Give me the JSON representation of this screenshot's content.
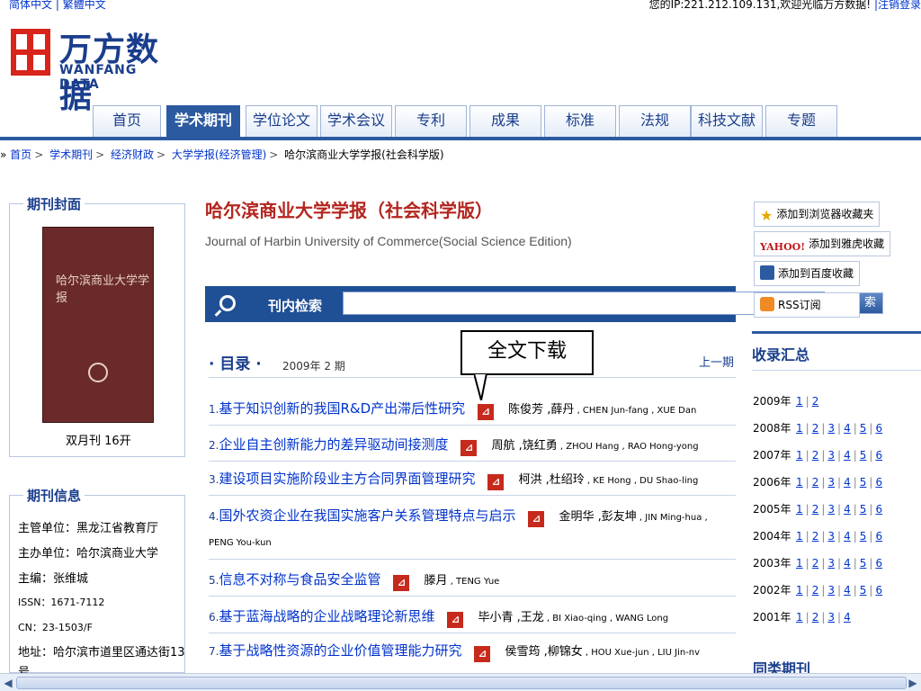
{
  "topbar": {
    "lang_simplified": "简体中文",
    "lang_sep": "|",
    "lang_traditional": "繁體中文",
    "welcome": "您的IP:221.212.109.131,欢迎光临万方数据!",
    "logout": "|注销登录"
  },
  "logo": {
    "cn": "万方数据",
    "en": "WANFANG DATA"
  },
  "nav": {
    "tabs": [
      {
        "label": "首页"
      },
      {
        "label": "学术期刊"
      },
      {
        "label": "学位论文"
      },
      {
        "label": "学术会议"
      },
      {
        "label": "专利"
      },
      {
        "label": "成果"
      },
      {
        "label": "标准"
      },
      {
        "label": "法规"
      },
      {
        "label": "科技文献"
      },
      {
        "label": "专题"
      }
    ]
  },
  "breadcrumb": {
    "items": [
      "首页",
      "学术期刊",
      "经济财政",
      "大学学报(经济管理)"
    ],
    "current": "哈尔滨商业大学学报(社会科学版)"
  },
  "left": {
    "cover_title": "期刊封面",
    "cover_text": "哈尔滨商业大学学报",
    "frequency": "双月刊  16开",
    "info_title": "期刊信息",
    "info": {
      "supervisor": "主管单位：黑龙江省教育厅",
      "sponsor": "主办单位：哈尔滨商业大学",
      "editor": "主编：张维城",
      "issn": "ISSN：1671-7112",
      "cn": "CN：23-1503/F",
      "address": "地址：哈尔滨市道里区通达街13",
      "address_cont": "号"
    }
  },
  "journal": {
    "title": "哈尔滨商业大学学报（社会科学版）",
    "subtitle": "Journal of Harbin University of Commerce(Social Science Edition)"
  },
  "search": {
    "label": "刊内检索",
    "value": "",
    "button": "检  索"
  },
  "callout": "全文下载",
  "toc": {
    "title": "· 目录 ·",
    "issue": "2009年 2 期",
    "prev": "上一期",
    "articles": [
      {
        "num": "1.",
        "title": "基于知识创新的我国R&D产出滞后性研究",
        "authors": "陈俊芳 ,薛丹",
        "eng": " , CHEN Jun-fang , XUE Dan"
      },
      {
        "num": "2.",
        "title": "企业自主创新能力的差异驱动间接测度",
        "authors": "周航 ,饶红勇",
        "eng": " , ZHOU Hang , RAO Hong-yong"
      },
      {
        "num": "3.",
        "title": "建设项目实施阶段业主方合同界面管理研究",
        "authors": "柯洪 ,杜绍玲",
        "eng": " , KE Hong , DU Shao-ling"
      },
      {
        "num": "4.",
        "title": "国外农资企业在我国实施客户关系管理特点与启示",
        "authors": "金明华 ,彭友坤",
        "eng": " , JIN Ming-hua ,",
        "eng_cont": "PENG You-kun"
      },
      {
        "num": "5.",
        "title": "信息不对称与食品安全监管",
        "authors": "滕月",
        "eng": " , TENG Yue"
      },
      {
        "num": "6.",
        "title": "基于蓝海战略的企业战略理论新思维",
        "authors": "毕小青 ,王龙",
        "eng": " , BI Xiao-qing , WANG Long"
      },
      {
        "num": "7.",
        "title": "基于战略性资源的企业价值管理能力研究",
        "authors": "侯雪筠 ,柳锦女",
        "eng": " , HOU Xue-jun , LIU Jin-nv"
      }
    ]
  },
  "right": {
    "add_browser": "添加到浏览器收藏夹",
    "yahoo_logo": "YAHOO!",
    "add_yahoo": "添加到雅虎收藏",
    "add_baidu": "添加到百度收藏",
    "rss": "RSS订阅",
    "archive_title": "收录汇总",
    "years": [
      {
        "year": "2009年",
        "issues": [
          "1",
          "2"
        ]
      },
      {
        "year": "2008年",
        "issues": [
          "1",
          "2",
          "3",
          "4",
          "5",
          "6"
        ]
      },
      {
        "year": "2007年",
        "issues": [
          "1",
          "2",
          "3",
          "4",
          "5",
          "6"
        ]
      },
      {
        "year": "2006年",
        "issues": [
          "1",
          "2",
          "3",
          "4",
          "5",
          "6"
        ]
      },
      {
        "year": "2005年",
        "issues": [
          "1",
          "2",
          "3",
          "4",
          "5",
          "6"
        ]
      },
      {
        "year": "2004年",
        "issues": [
          "1",
          "2",
          "3",
          "4",
          "5",
          "6"
        ]
      },
      {
        "year": "2003年",
        "issues": [
          "1",
          "2",
          "3",
          "4",
          "5",
          "6"
        ]
      },
      {
        "year": "2002年",
        "issues": [
          "1",
          "2",
          "3",
          "4",
          "5",
          "6"
        ]
      },
      {
        "year": "2001年",
        "issues": [
          "1",
          "2",
          "3",
          "4"
        ]
      }
    ],
    "same_type": "同类期刊"
  },
  "colors": {
    "brand_blue": "#1a3e8c",
    "nav_active": "#2c5aa0",
    "brand_red": "#d8241b",
    "link": "#0033cc"
  }
}
